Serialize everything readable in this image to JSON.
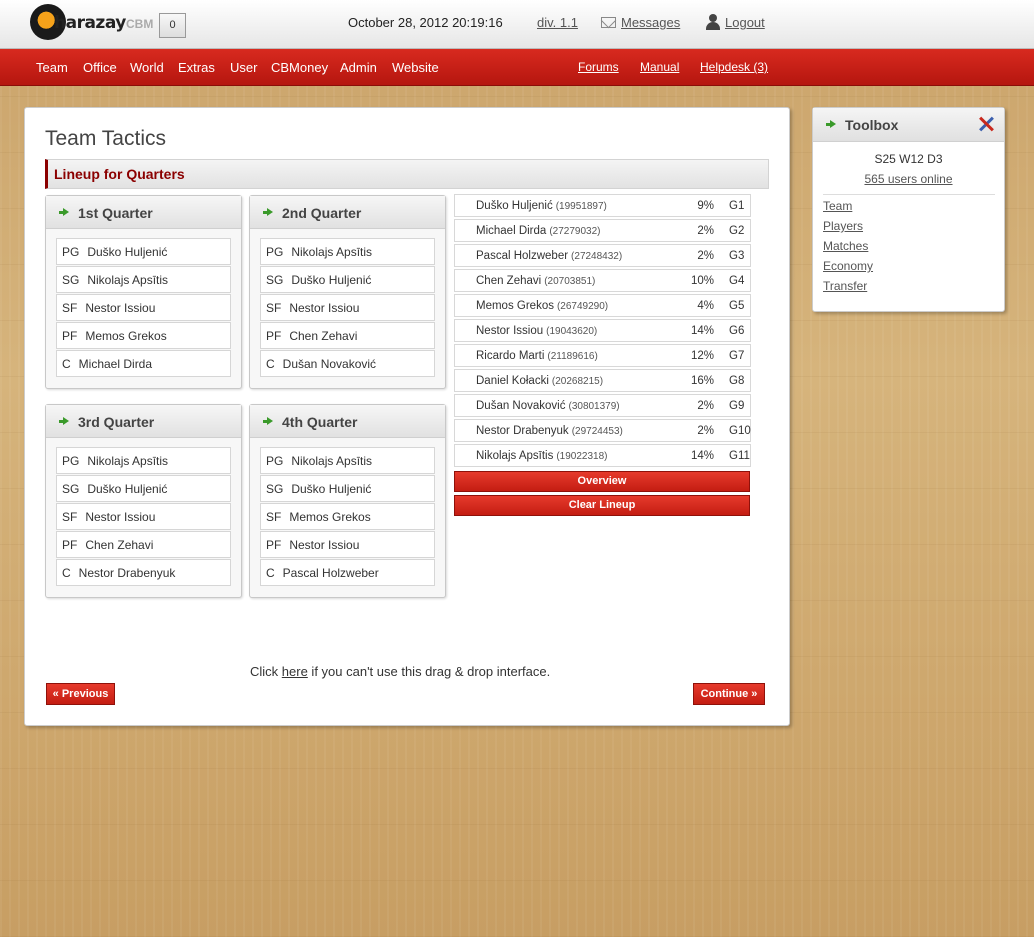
{
  "topbar": {
    "logo_text": "harazay",
    "logo_suffix": "CBM",
    "counter": "0",
    "datetime": "October 28, 2012 20:19:16",
    "division": "div. 1.1",
    "messages": "Messages",
    "logout": "Logout"
  },
  "nav": {
    "items": [
      "Team",
      "Office",
      "World",
      "Extras",
      "User",
      "CBMoney",
      "Admin",
      "Website"
    ],
    "right": [
      "Forums",
      "Manual",
      "Helpdesk (3)"
    ]
  },
  "page": {
    "title": "Team Tactics",
    "section": "Lineup for Quarters"
  },
  "quarters": [
    {
      "title": "1st Quarter",
      "slots": [
        {
          "pos": "PG",
          "name": "Duško Huljenić"
        },
        {
          "pos": "SG",
          "name": "Nikolajs Apsītis"
        },
        {
          "pos": "SF",
          "name": "Nestor Issiou"
        },
        {
          "pos": "PF",
          "name": "Memos Grekos"
        },
        {
          "pos": "C",
          "name": "Michael Dirda"
        }
      ]
    },
    {
      "title": "2nd Quarter",
      "slots": [
        {
          "pos": "PG",
          "name": "Nikolajs Apsītis"
        },
        {
          "pos": "SG",
          "name": "Duško Huljenić"
        },
        {
          "pos": "SF",
          "name": "Nestor Issiou"
        },
        {
          "pos": "PF",
          "name": "Chen Zehavi"
        },
        {
          "pos": "C",
          "name": "Dušan Novaković"
        }
      ]
    },
    {
      "title": "3rd Quarter",
      "slots": [
        {
          "pos": "PG",
          "name": "Nikolajs Apsītis"
        },
        {
          "pos": "SG",
          "name": "Duško Huljenić"
        },
        {
          "pos": "SF",
          "name": "Nestor Issiou"
        },
        {
          "pos": "PF",
          "name": "Chen Zehavi"
        },
        {
          "pos": "C",
          "name": "Nestor Drabenyuk"
        }
      ]
    },
    {
      "title": "4th Quarter",
      "slots": [
        {
          "pos": "PG",
          "name": "Nikolajs Apsītis"
        },
        {
          "pos": "SG",
          "name": "Duško Huljenić"
        },
        {
          "pos": "SF",
          "name": "Memos Grekos"
        },
        {
          "pos": "PF",
          "name": "Nestor Issiou"
        },
        {
          "pos": "C",
          "name": "Pascal Holzweber"
        }
      ]
    }
  ],
  "players": [
    {
      "name": "Duško Huljenić",
      "id": "(19951897)",
      "pct": "9%",
      "group": "G1"
    },
    {
      "name": "Michael Dirda",
      "id": "(27279032)",
      "pct": "2%",
      "group": "G2"
    },
    {
      "name": "Pascal Holzweber",
      "id": "(27248432)",
      "pct": "2%",
      "group": "G3"
    },
    {
      "name": "Chen Zehavi",
      "id": "(20703851)",
      "pct": "10%",
      "group": "G4"
    },
    {
      "name": "Memos Grekos",
      "id": "(26749290)",
      "pct": "4%",
      "group": "G5"
    },
    {
      "name": "Nestor Issiou",
      "id": "(19043620)",
      "pct": "14%",
      "group": "G6"
    },
    {
      "name": "Ricardo Marti",
      "id": "(21189616)",
      "pct": "12%",
      "group": "G7"
    },
    {
      "name": "Daniel Kołacki",
      "id": "(20268215)",
      "pct": "16%",
      "group": "G8"
    },
    {
      "name": "Dušan Novaković",
      "id": "(30801379)",
      "pct": "2%",
      "group": "G9"
    },
    {
      "name": "Nestor Drabenyuk",
      "id": "(29724453)",
      "pct": "2%",
      "group": "G10"
    },
    {
      "name": "Nikolajs Apsītis",
      "id": "(19022318)",
      "pct": "14%",
      "group": "G11"
    }
  ],
  "buttons": {
    "overview": "Overview",
    "clear": "Clear Lineup",
    "previous": "« Previous",
    "continue": "Continue »"
  },
  "drag_note": {
    "before": "Click ",
    "link": "here",
    "after": " if you can't use this drag & drop interface."
  },
  "toolbox": {
    "title": "Toolbox",
    "season": "S25 W12 D3",
    "online": "565 users online",
    "links": [
      "Team",
      "Players",
      "Matches",
      "Economy",
      "Transfer"
    ]
  },
  "colors": {
    "accent_red": "#c41d12",
    "section_title": "#8b0000",
    "arrow_green": "#3a9a2a"
  },
  "icons": [
    "message-icon",
    "user-icon",
    "arrow-right-icon",
    "tools-icon"
  ]
}
